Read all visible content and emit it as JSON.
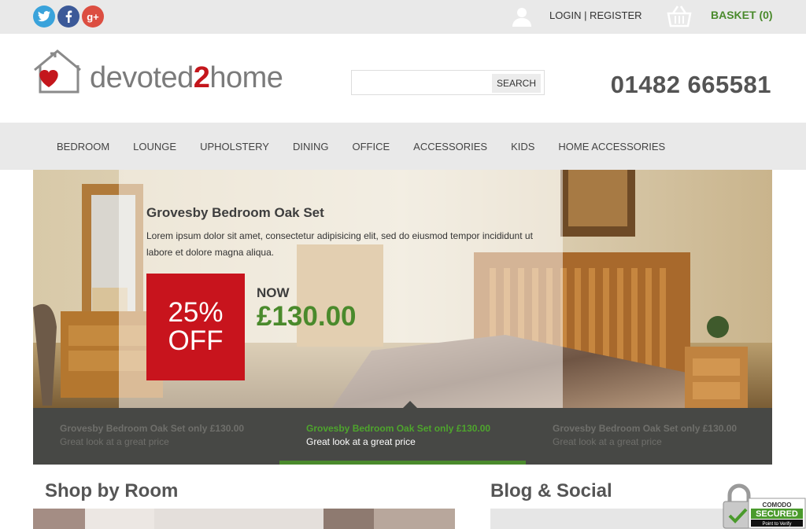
{
  "topbar": {
    "social": [
      {
        "name": "twitter",
        "glyph": "t",
        "color": "#3aa3db"
      },
      {
        "name": "facebook",
        "glyph": "f",
        "color": "#3b5998"
      },
      {
        "name": "google-plus",
        "glyph": "g+",
        "color": "#dc4e41"
      }
    ],
    "login_label": "LOGIN | REGISTER",
    "basket_label": "BASKET (0)"
  },
  "header": {
    "logo_text_a": "devoted",
    "logo_text_b": "2",
    "logo_text_c": "home",
    "search_placeholder": "",
    "search_button": "SEARCH",
    "phone": "01482 665581"
  },
  "nav": {
    "items": [
      "BEDROOM",
      "LOUNGE",
      "UPHOLSTERY",
      "DINING",
      "OFFICE",
      "ACCESSORIES",
      "KIDS",
      "HOME ACCESSORIES"
    ]
  },
  "hero": {
    "title": "Grovesby Bedroom Oak Set",
    "description": "Lorem ipsum dolor sit amet, consectetur adipisicing elit, sed do eiusmod tempor incididunt ut labore et dolore magna aliqua.",
    "discount_line1": "25%",
    "discount_line2": "OFF",
    "now_label": "NOW",
    "price": "£130.00"
  },
  "slides": [
    {
      "title": "Grovesby Bedroom Oak Set only £130.00",
      "subtitle": "Great look at a great price",
      "active": false
    },
    {
      "title": "Grovesby Bedroom Oak Set only £130.00",
      "subtitle": "Great look at a great price",
      "active": true
    },
    {
      "title": "Grovesby Bedroom Oak Set only £130.00",
      "subtitle": "Great look at a great price",
      "active": false
    }
  ],
  "sections": {
    "shop_by_room": "Shop by Room",
    "blog_social": "Blog & Social"
  },
  "badge": {
    "line1": "COMODO",
    "line2": "SECURED",
    "line3": "Point to Verify"
  },
  "colors": {
    "accent_green": "#4a8a2c",
    "brand_red": "#c8141d",
    "nav_bg": "#e9e9e9",
    "slides_bg": "#474845"
  }
}
